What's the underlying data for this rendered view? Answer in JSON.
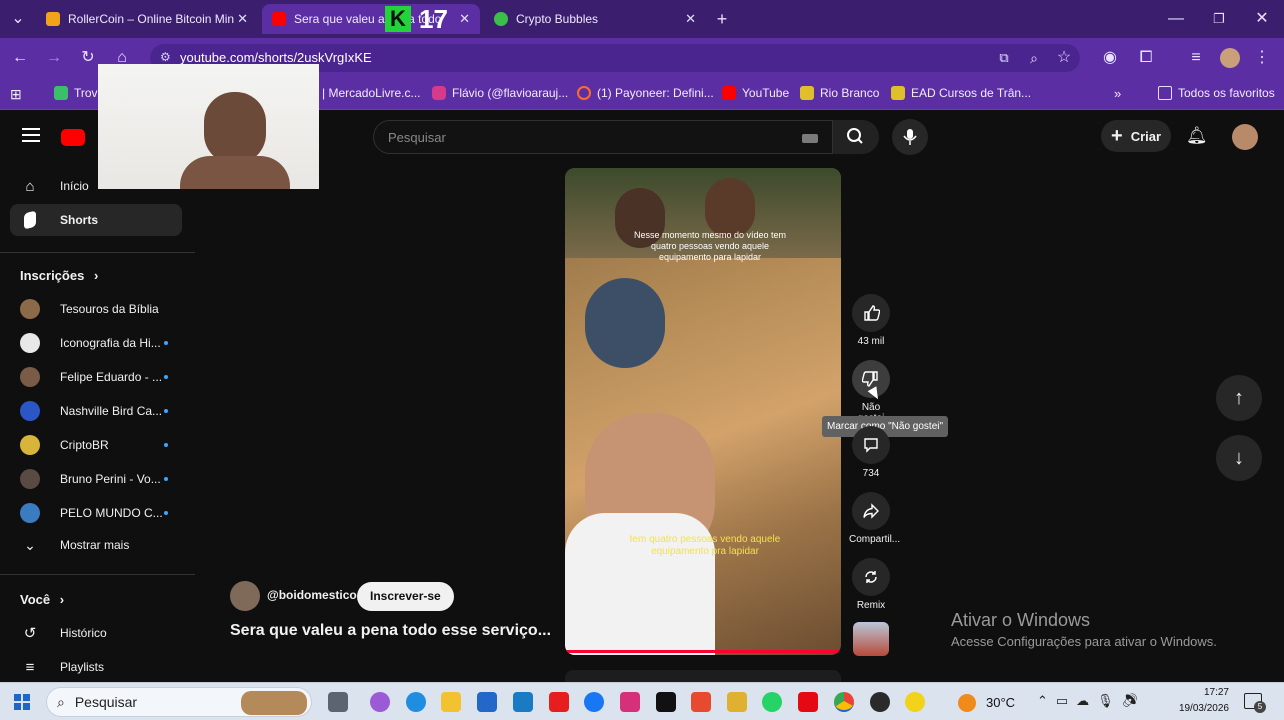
{
  "browser": {
    "tabs": [
      {
        "title": "RollerCoin – Online Bitcoin Min",
        "active": false
      },
      {
        "title": "Sera que valeu a pena todo",
        "active": true
      },
      {
        "title": "Crypto Bubbles",
        "active": false
      }
    ],
    "overlay_number": "17",
    "url": "youtube.com/shorts/2uskVrgIxKE",
    "bookmarks": [
      "Trov",
      "| MercadoLivre.c...",
      "Flávio (@flavioarauj...",
      "(1) Payoneer: Defini...",
      "YouTube",
      "Rio Branco",
      "EAD Cursos de Trân..."
    ],
    "bookmarks_all": "Todos os favoritos"
  },
  "youtube": {
    "search_placeholder": "Pesquisar",
    "create_label": "Criar",
    "sidebar": {
      "home": "Início",
      "shorts": "Shorts",
      "subscriptions_header": "Inscrições",
      "subscriptions": [
        {
          "name": "Tesouros da Bíblia",
          "color": "#8b6a4a",
          "dot": false
        },
        {
          "name": "Iconografia da Hi...",
          "color": "#e8e8e8",
          "dot": true
        },
        {
          "name": "Felipe Eduardo - ...",
          "color": "#7a5b48",
          "dot": true
        },
        {
          "name": "Nashville Bird Ca...",
          "color": "#2a56c6",
          "dot": true
        },
        {
          "name": "CriptoBR",
          "color": "#d8b43a",
          "dot": true
        },
        {
          "name": "Bruno Perini - Vo...",
          "color": "#5a4a44",
          "dot": true
        },
        {
          "name": "PELO MUNDO C...",
          "color": "#3b7bbf",
          "dot": true
        }
      ],
      "show_more": "Mostrar mais",
      "you_header": "Você",
      "history": "Histórico",
      "playlists": "Playlists"
    },
    "short": {
      "channel": "@boidomestico",
      "subscribe_label": "Inscrever-se",
      "title": "Sera que valeu a pena todo esse serviço...",
      "caption_top": "Nesse momento mesmo do vídeo tem quatro pessoas vendo aquele equipamento para lapidar",
      "caption_bottom": "tem quatro pessoas vendo aquele equipamento pra lapidar",
      "like_count": "43 mil",
      "dislike_label": "Não gostei",
      "dislike_tooltip": "Marcar como \"Não gostei\"",
      "comment_count": "734",
      "share_label": "Compartil...",
      "remix_label": "Remix"
    },
    "windows_watermark": {
      "title": "Ativar o Windows",
      "subtitle": "Acesse Configurações para ativar o Windows."
    }
  },
  "taskbar": {
    "search_label": "Pesquisar",
    "weather": "30°C",
    "time": "17:27",
    "date": "19/03/2026",
    "notification_count": "5"
  }
}
